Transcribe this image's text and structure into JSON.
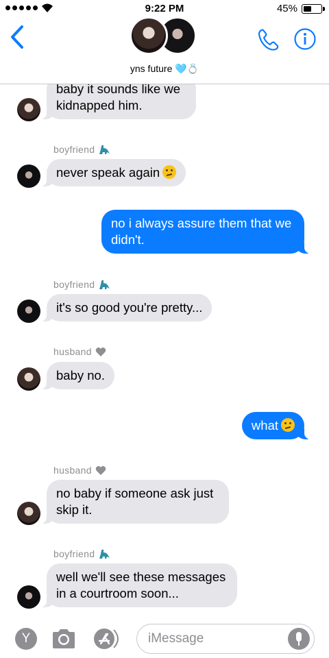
{
  "status_bar": {
    "time": "9:22 PM",
    "battery": "45%",
    "battery_level": 0.45
  },
  "header": {
    "group_name": "yns future 🩵💍",
    "back_icon": "chevron-left-icon",
    "call_icon": "phone-icon",
    "info_icon": "info-icon",
    "accent_color": "#0b7cff"
  },
  "messages": [
    {
      "direction": "in",
      "sender": "husband",
      "text": "baby it sounds like we kidnapped him."
    },
    {
      "direction": "in",
      "sender": "boyfriend",
      "sender_label": "boyfriend",
      "text": "never speak again"
    },
    {
      "direction": "out",
      "text": "no i always assure them that we didn't."
    },
    {
      "direction": "in",
      "sender": "boyfriend",
      "sender_label": "boyfriend",
      "text": "it's so good you're pretty..."
    },
    {
      "direction": "in",
      "sender": "husband",
      "sender_label": "husband",
      "text": "baby no."
    },
    {
      "direction": "out",
      "text": "what"
    },
    {
      "direction": "in",
      "sender": "husband",
      "sender_label": "husband",
      "text": "no baby if someone ask just skip it."
    },
    {
      "direction": "in",
      "sender": "boyfriend",
      "sender_label": "boyfriend",
      "text": "well we'll see these messages in a courtroom soon..."
    }
  ],
  "input_bar": {
    "placeholder": "iMessage",
    "app_button_label": "Y"
  },
  "colors": {
    "incoming_bubble": "#e5e5ea",
    "outgoing_bubble": "#0b7cff",
    "sender_label": "#8e8e93"
  }
}
